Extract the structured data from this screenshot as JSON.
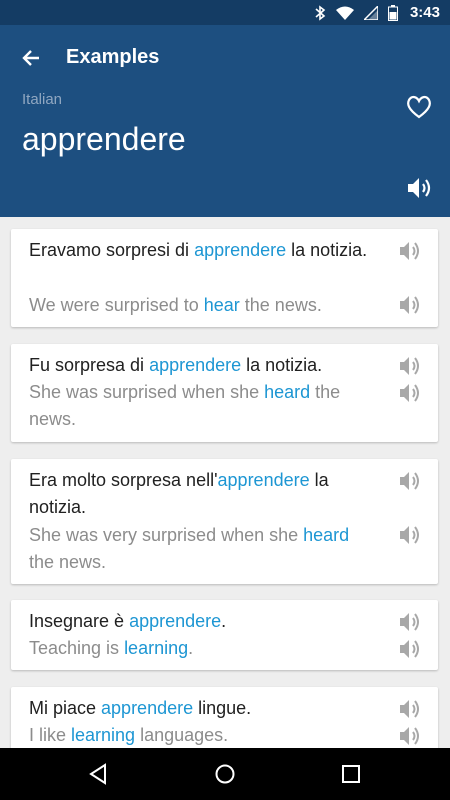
{
  "status_bar": {
    "time": "3:43"
  },
  "header": {
    "title": "Examples",
    "language": "Italian",
    "word": "apprendere"
  },
  "examples": [
    {
      "source": [
        {
          "text": "Eravamo sorpresi di "
        },
        {
          "text": "apprendere",
          "hl": true
        },
        {
          "text": " la notizia."
        }
      ],
      "translation": [
        {
          "text": "We were surprised to "
        },
        {
          "text": "hear",
          "hl": true
        },
        {
          "text": " the news."
        }
      ]
    },
    {
      "source": [
        {
          "text": "Fu sorpresa di "
        },
        {
          "text": "apprendere",
          "hl": true
        },
        {
          "text": " la notizia."
        }
      ],
      "translation": [
        {
          "text": "She was surprised when she "
        },
        {
          "text": "heard",
          "hl": true
        },
        {
          "text": " the news."
        }
      ]
    },
    {
      "source": [
        {
          "text": "Era molto sorpresa nell'"
        },
        {
          "text": "apprendere",
          "hl": true
        },
        {
          "text": " la notizia."
        }
      ],
      "translation": [
        {
          "text": "She was very surprised when she "
        },
        {
          "text": "heard",
          "hl": true
        },
        {
          "text": " the news."
        }
      ]
    },
    {
      "source": [
        {
          "text": "Insegnare è "
        },
        {
          "text": "apprendere",
          "hl": true
        },
        {
          "text": "."
        }
      ],
      "translation": [
        {
          "text": "Teaching is "
        },
        {
          "text": "learning",
          "hl": true
        },
        {
          "text": "."
        }
      ]
    },
    {
      "source": [
        {
          "text": "Mi piace "
        },
        {
          "text": "apprendere",
          "hl": true
        },
        {
          "text": " lingue."
        }
      ],
      "translation": [
        {
          "text": "I like "
        },
        {
          "text": "learning",
          "hl": true
        },
        {
          "text": " languages."
        }
      ]
    }
  ],
  "icons": {
    "back": "arrow-back-icon",
    "favorite": "heart-outline-icon",
    "speaker": "speaker-icon",
    "nav_back": "triangle-back-icon",
    "nav_home": "circle-home-icon",
    "nav_recents": "square-recents-icon"
  },
  "colors": {
    "header": "#1d4f80",
    "status_bar": "#143c64",
    "highlight": "#1d96d3",
    "translation": "#8c8c8c"
  }
}
